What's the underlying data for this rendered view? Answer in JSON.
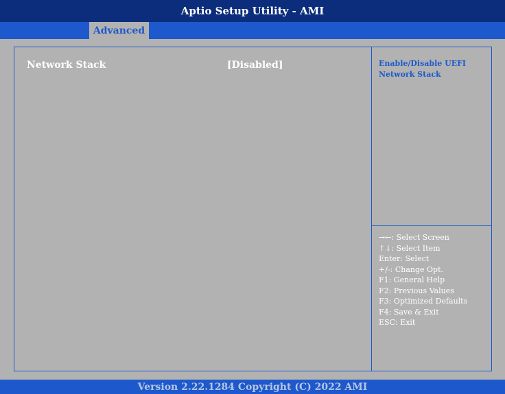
{
  "title": "Aptio Setup Utility - AMI",
  "tabs": [
    {
      "label": "Advanced",
      "active": true
    }
  ],
  "settings": [
    {
      "label": "Network Stack",
      "value": "[Disabled]"
    }
  ],
  "help": {
    "text": "Enable/Disable UEFI Network Stack"
  },
  "keys": [
    "→←: Select Screen",
    "↑↓: Select Item",
    "Enter: Select",
    "+/-: Change Opt.",
    "F1: General Help",
    "F2: Previous Values",
    "F3: Optimized Defaults",
    "F4: Save & Exit",
    "ESC: Exit"
  ],
  "footer": "Version 2.22.1284 Copyright (C) 2022 AMI",
  "colors": {
    "title_bar": "#0b2d7b",
    "accent_blue": "#1d59cc",
    "background": "#b2b2b2",
    "text": "#ffffff"
  }
}
